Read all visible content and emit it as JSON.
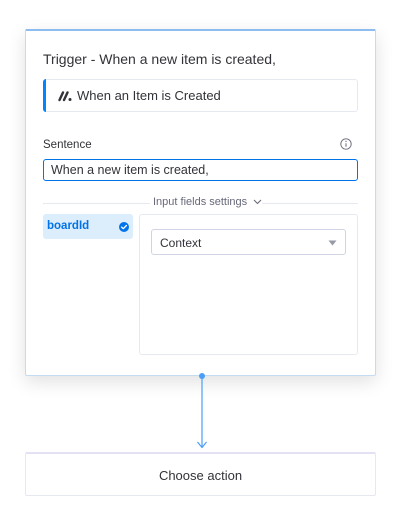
{
  "trigger_card": {
    "title": "Trigger - When a new item is created,",
    "trigger_name": "When an Item is Created",
    "logo_icon": "monday-logo-icon",
    "accent_color": "#0085ff"
  },
  "sentence": {
    "label": "Sentence",
    "value": "When a new item is created,",
    "info_icon": "info-icon"
  },
  "input_fields": {
    "toggle_label": "Input fields settings",
    "toggle_icon": "chevron-down-icon",
    "params": [
      {
        "label": "boardId",
        "status_icon": "check-circle-icon"
      }
    ],
    "mapping": {
      "selected": "Context",
      "icon": "caret-down-icon"
    }
  },
  "action_card": {
    "label": "Choose action"
  },
  "colors": {
    "primary": "#0073ea",
    "selected_bg": "#dcedfb",
    "connector": "#4a9ff5"
  }
}
